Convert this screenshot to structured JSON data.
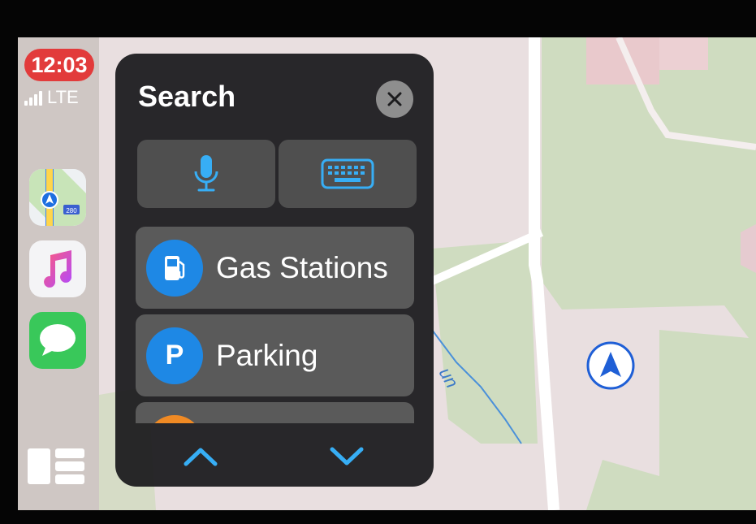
{
  "status": {
    "time": "12:03",
    "network": "LTE"
  },
  "dock": {
    "apps": [
      {
        "name": "Maps",
        "icon": "maps-app-icon"
      },
      {
        "name": "Music",
        "icon": "music-app-icon"
      },
      {
        "name": "Messages",
        "icon": "messages-app-icon"
      }
    ],
    "dashboard_icon": "dashboard-icon"
  },
  "search_panel": {
    "title": "Search",
    "close_icon": "close-icon",
    "input_buttons": [
      {
        "icon": "microphone-icon"
      },
      {
        "icon": "keyboard-icon"
      }
    ],
    "categories": [
      {
        "label": "Gas Stations",
        "icon": "gas-pump-icon",
        "color": "#1e88e5"
      },
      {
        "label": "Parking",
        "icon_text": "P",
        "color": "#1e88e5"
      },
      {
        "label": "",
        "icon": "category-icon",
        "color": "#f08a24"
      }
    ],
    "scroll_controls": [
      {
        "icon": "chevron-up-icon"
      },
      {
        "icon": "chevron-down-icon"
      }
    ]
  },
  "map": {
    "road_label": "un",
    "location_marker": "current-location-icon",
    "colors": {
      "land": "#e9dfe0",
      "park": "#cfdcc0",
      "road": "#ffffff",
      "water": "#4a90d9"
    }
  },
  "colors": {
    "clock": "#e23b3b",
    "panel": "#1c1c1e",
    "button": "#4f4f4f",
    "accent": "#37aef5"
  }
}
